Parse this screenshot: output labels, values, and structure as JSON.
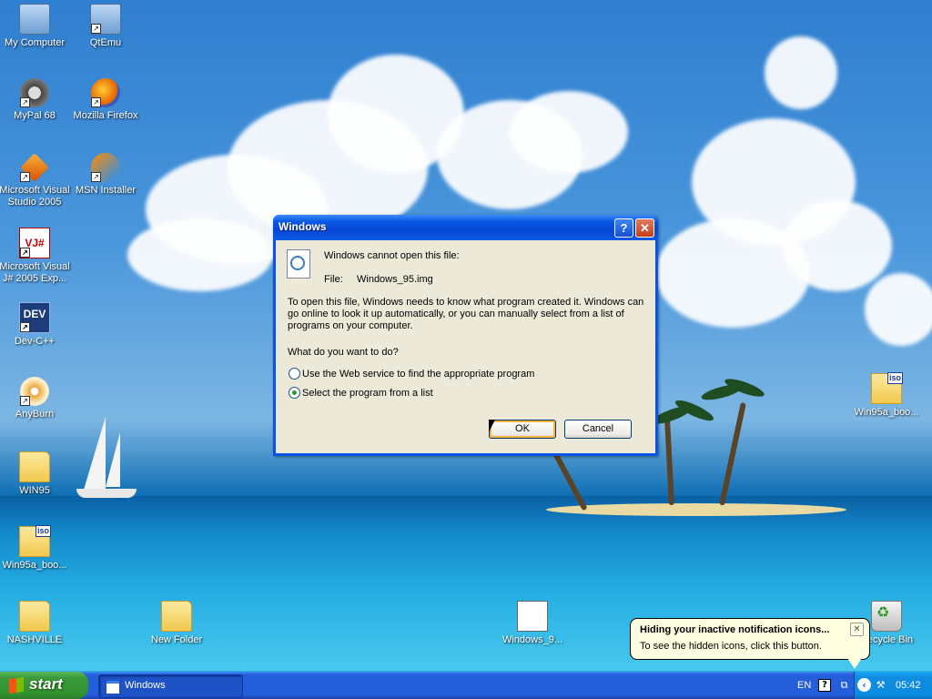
{
  "desktop": {
    "icons": [
      {
        "label": "My Computer"
      },
      {
        "label": "QtEmu"
      },
      {
        "label": "MyPal 68"
      },
      {
        "label": "Mozilla Firefox"
      },
      {
        "label": "Microsoft Visual Studio 2005"
      },
      {
        "label": "MSN Installer"
      },
      {
        "label": "Microsoft Visual J# 2005 Exp..."
      },
      {
        "label": "Dev-C++"
      },
      {
        "label": "AnyBurn"
      },
      {
        "label": "WIN95"
      },
      {
        "label": "Win95a_boo..."
      },
      {
        "label": "NASHVILLE"
      },
      {
        "label": "New Folder"
      },
      {
        "label": "Windows_9..."
      },
      {
        "label": "Win95a_boo..."
      },
      {
        "label": "Recycle Bin"
      }
    ],
    "iso_badge": "iso",
    "vj_badge": "VJ#",
    "dev_badge": "DEV"
  },
  "dialog": {
    "title": "Windows",
    "help_glyph": "?",
    "close_glyph": "✕",
    "heading": "Windows cannot open this file:",
    "file_label": "File:",
    "file_name": "Windows_95.img",
    "explanation": "To open this file, Windows needs to know what program created it.  Windows can go online to look it up automatically, or you can manually select from a list of programs on your computer.",
    "question": "What do you want to do?",
    "options": [
      {
        "label": "Use the Web service to find the appropriate program",
        "selected": false
      },
      {
        "label": "Select the program from a list",
        "selected": true
      }
    ],
    "ok_label": "OK",
    "cancel_label": "Cancel"
  },
  "balloon": {
    "title": "Hiding your inactive notification icons...",
    "text": "To see the hidden icons, click this button.",
    "close_glyph": "✕"
  },
  "taskbar": {
    "start_label": "start",
    "tasks": [
      {
        "label": "Windows"
      }
    ],
    "language": "EN",
    "help_glyph": "?",
    "chevron_glyph": "‹",
    "clock": "05:42"
  },
  "colors": {
    "taskbar_blue": "#245edb",
    "start_green": "#3c9b3c",
    "dialog_face": "#ece9d8",
    "titlebar_blue": "#0646d4",
    "balloon_bg": "#ffffe1"
  }
}
